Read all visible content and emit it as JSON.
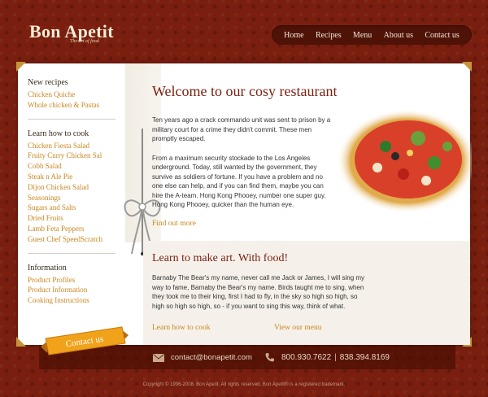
{
  "brand": {
    "name": "Bon Apetit",
    "tagline": "The art of food"
  },
  "nav": [
    "Home",
    "Recipes",
    "Menu",
    "About us",
    "Contact us"
  ],
  "sidebar": {
    "new_recipes": {
      "heading": "New recipes",
      "items": [
        "Chicken Quiche",
        "Whole chicken & Pastas"
      ]
    },
    "learn": {
      "heading": "Learn how to cook",
      "items": [
        "Chicken Fiesta Salad",
        "Fruity Curry Chicken Sal",
        "Cobb Salad",
        "Steak n Ale Pie",
        "Dijon Chicken Salad",
        "Seasonings",
        "Sugars and Salts",
        "Dried Fruits",
        "Lamb Feta Peppers",
        "Guest Chef SpeedScratch"
      ]
    },
    "information": {
      "heading": "Information",
      "items": [
        "Product Profiles",
        "Product Information",
        "Cooking Instructions"
      ]
    }
  },
  "welcome": {
    "title": "Welcome to our cosy restaurant",
    "p1": "Ten years ago a crack commando unit was sent to prison by a military court for a crime they didn't commit. These men promptly escaped.",
    "p2": "From a maximum security stockade to the Los Angeles underground. Today, still wanted by the government, they survive as soldiers of fortune. If you have a problem and no one else can help, and if you can find them, maybe you can hire the A-team. Hong Kong Phooey, number one super guy. Hong Kong Phooey, quicker than the human eye.",
    "link": "Find out more"
  },
  "learn": {
    "title": "Learn to make art. With food!",
    "p": "Barnaby The Bear's my name, never call me Jack or James, I will sing my way to fame, Barnaby the Bear's my name. Birds taught me to sing, when they took me to their king, first I had to fly, in the sky so high so high, so high so high so high, so - if you want to sing this way, think of what.",
    "links": [
      "Learn how to cook",
      "View our menu"
    ]
  },
  "ribbon": "Contact us",
  "contact": {
    "email": "contact@bonapetit.com",
    "phone1": "800.930.7622",
    "separator": "|",
    "phone2": "838.394.8169"
  },
  "copyright": "Copyright © 1996-2008. Bon Apetit. All rights reserved. Bon Apetit® is a registered trademark.",
  "colors": {
    "background": "#7a1f0f",
    "accent": "#c8861f",
    "heading": "#7a1f0f"
  }
}
